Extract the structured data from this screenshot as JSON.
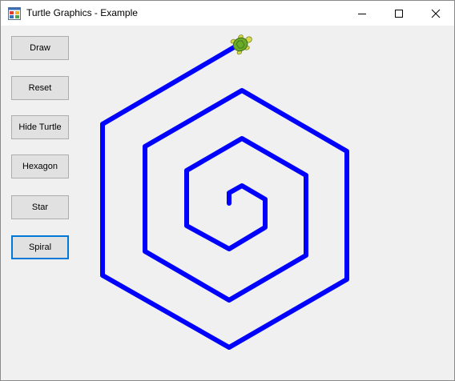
{
  "window": {
    "title": "Turtle Graphics - Example"
  },
  "titlebar_buttons": {
    "minimize_icon": "minimize-icon",
    "maximize_icon": "maximize-icon",
    "close_icon": "close-icon"
  },
  "buttons": {
    "draw": "Draw",
    "reset": "Reset",
    "hide_turtle": "Hide Turtle",
    "hexagon": "Hexagon",
    "star": "Star",
    "spiral": "Spiral"
  },
  "canvas": {
    "stroke_color": "#0000ff",
    "turtle_icon": "turtle-icon",
    "turtle_shell_color": "#6aaa2a",
    "turtle_skin_color": "#d8d84a"
  }
}
